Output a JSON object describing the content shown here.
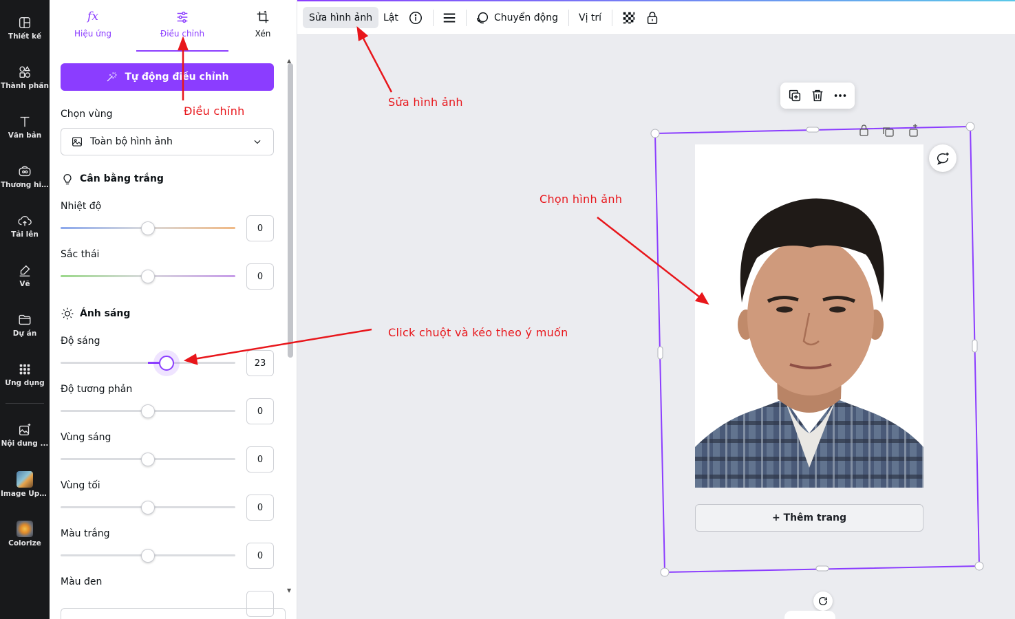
{
  "sidebar": {
    "items": [
      {
        "label": "Thiết kế",
        "icon": "layout-icon"
      },
      {
        "label": "Thành phần",
        "icon": "shapes-icon"
      },
      {
        "label": "Văn bản",
        "icon": "text-icon"
      },
      {
        "label": "Thương hi...",
        "icon": "brand-icon"
      },
      {
        "label": "Tải lên",
        "icon": "cloud-upload-icon"
      },
      {
        "label": "Vẽ",
        "icon": "pen-icon"
      },
      {
        "label": "Dự án",
        "icon": "folder-icon"
      },
      {
        "label": "Ứng dụng",
        "icon": "apps-grid-icon"
      },
      {
        "label": "Nội dung ...",
        "icon": "magic-media-icon"
      },
      {
        "label": "Image Ups...",
        "icon": "image-upscaler-app-icon"
      },
      {
        "label": "Colorize",
        "icon": "colorize-app-icon"
      }
    ]
  },
  "panel": {
    "tabs": [
      {
        "label": "Hiệu ứng",
        "icon": "fx-icon"
      },
      {
        "label": "Điều chỉnh",
        "icon": "sliders-icon"
      },
      {
        "label": "Xén",
        "icon": "crop-icon"
      }
    ],
    "auto_adjust": "Tự động điều chỉnh",
    "select_area_label": "Chọn vùng",
    "select_area_value": "Toàn bộ hình ảnh",
    "white_balance": "Cân bằng trắng",
    "light": "Ánh sáng",
    "sliders": [
      {
        "label": "Nhiệt độ",
        "value": "0",
        "position": 0.5
      },
      {
        "label": "Sắc thái",
        "value": "0",
        "position": 0.5
      },
      {
        "label": "Độ sáng",
        "value": "23",
        "position": 0.615
      },
      {
        "label": "Độ tương phản",
        "value": "0",
        "position": 0.5
      },
      {
        "label": "Vùng sáng",
        "value": "0",
        "position": 0.5
      },
      {
        "label": "Vùng tối",
        "value": "0",
        "position": 0.5
      },
      {
        "label": "Màu trắng",
        "value": "0",
        "position": 0.5
      },
      {
        "label": "Màu đen",
        "value": "",
        "position": 0.5
      }
    ]
  },
  "toolbar": {
    "edit_image": "Sửa hình ảnh",
    "flip": "Lật",
    "animate": "Chuyển động",
    "position": "Vị trí"
  },
  "canvas": {
    "add_page": "+ Thêm trang"
  },
  "annotations": {
    "adjust": "Điều chỉnh",
    "edit_image": "Sửa hình ảnh",
    "select_image": "Chọn hình ảnh",
    "drag": "Click chuột và kéo theo ý muốn"
  },
  "colors": {
    "accent": "#8b3dff",
    "rail": "#18191b",
    "annotation": "#e8161b"
  }
}
